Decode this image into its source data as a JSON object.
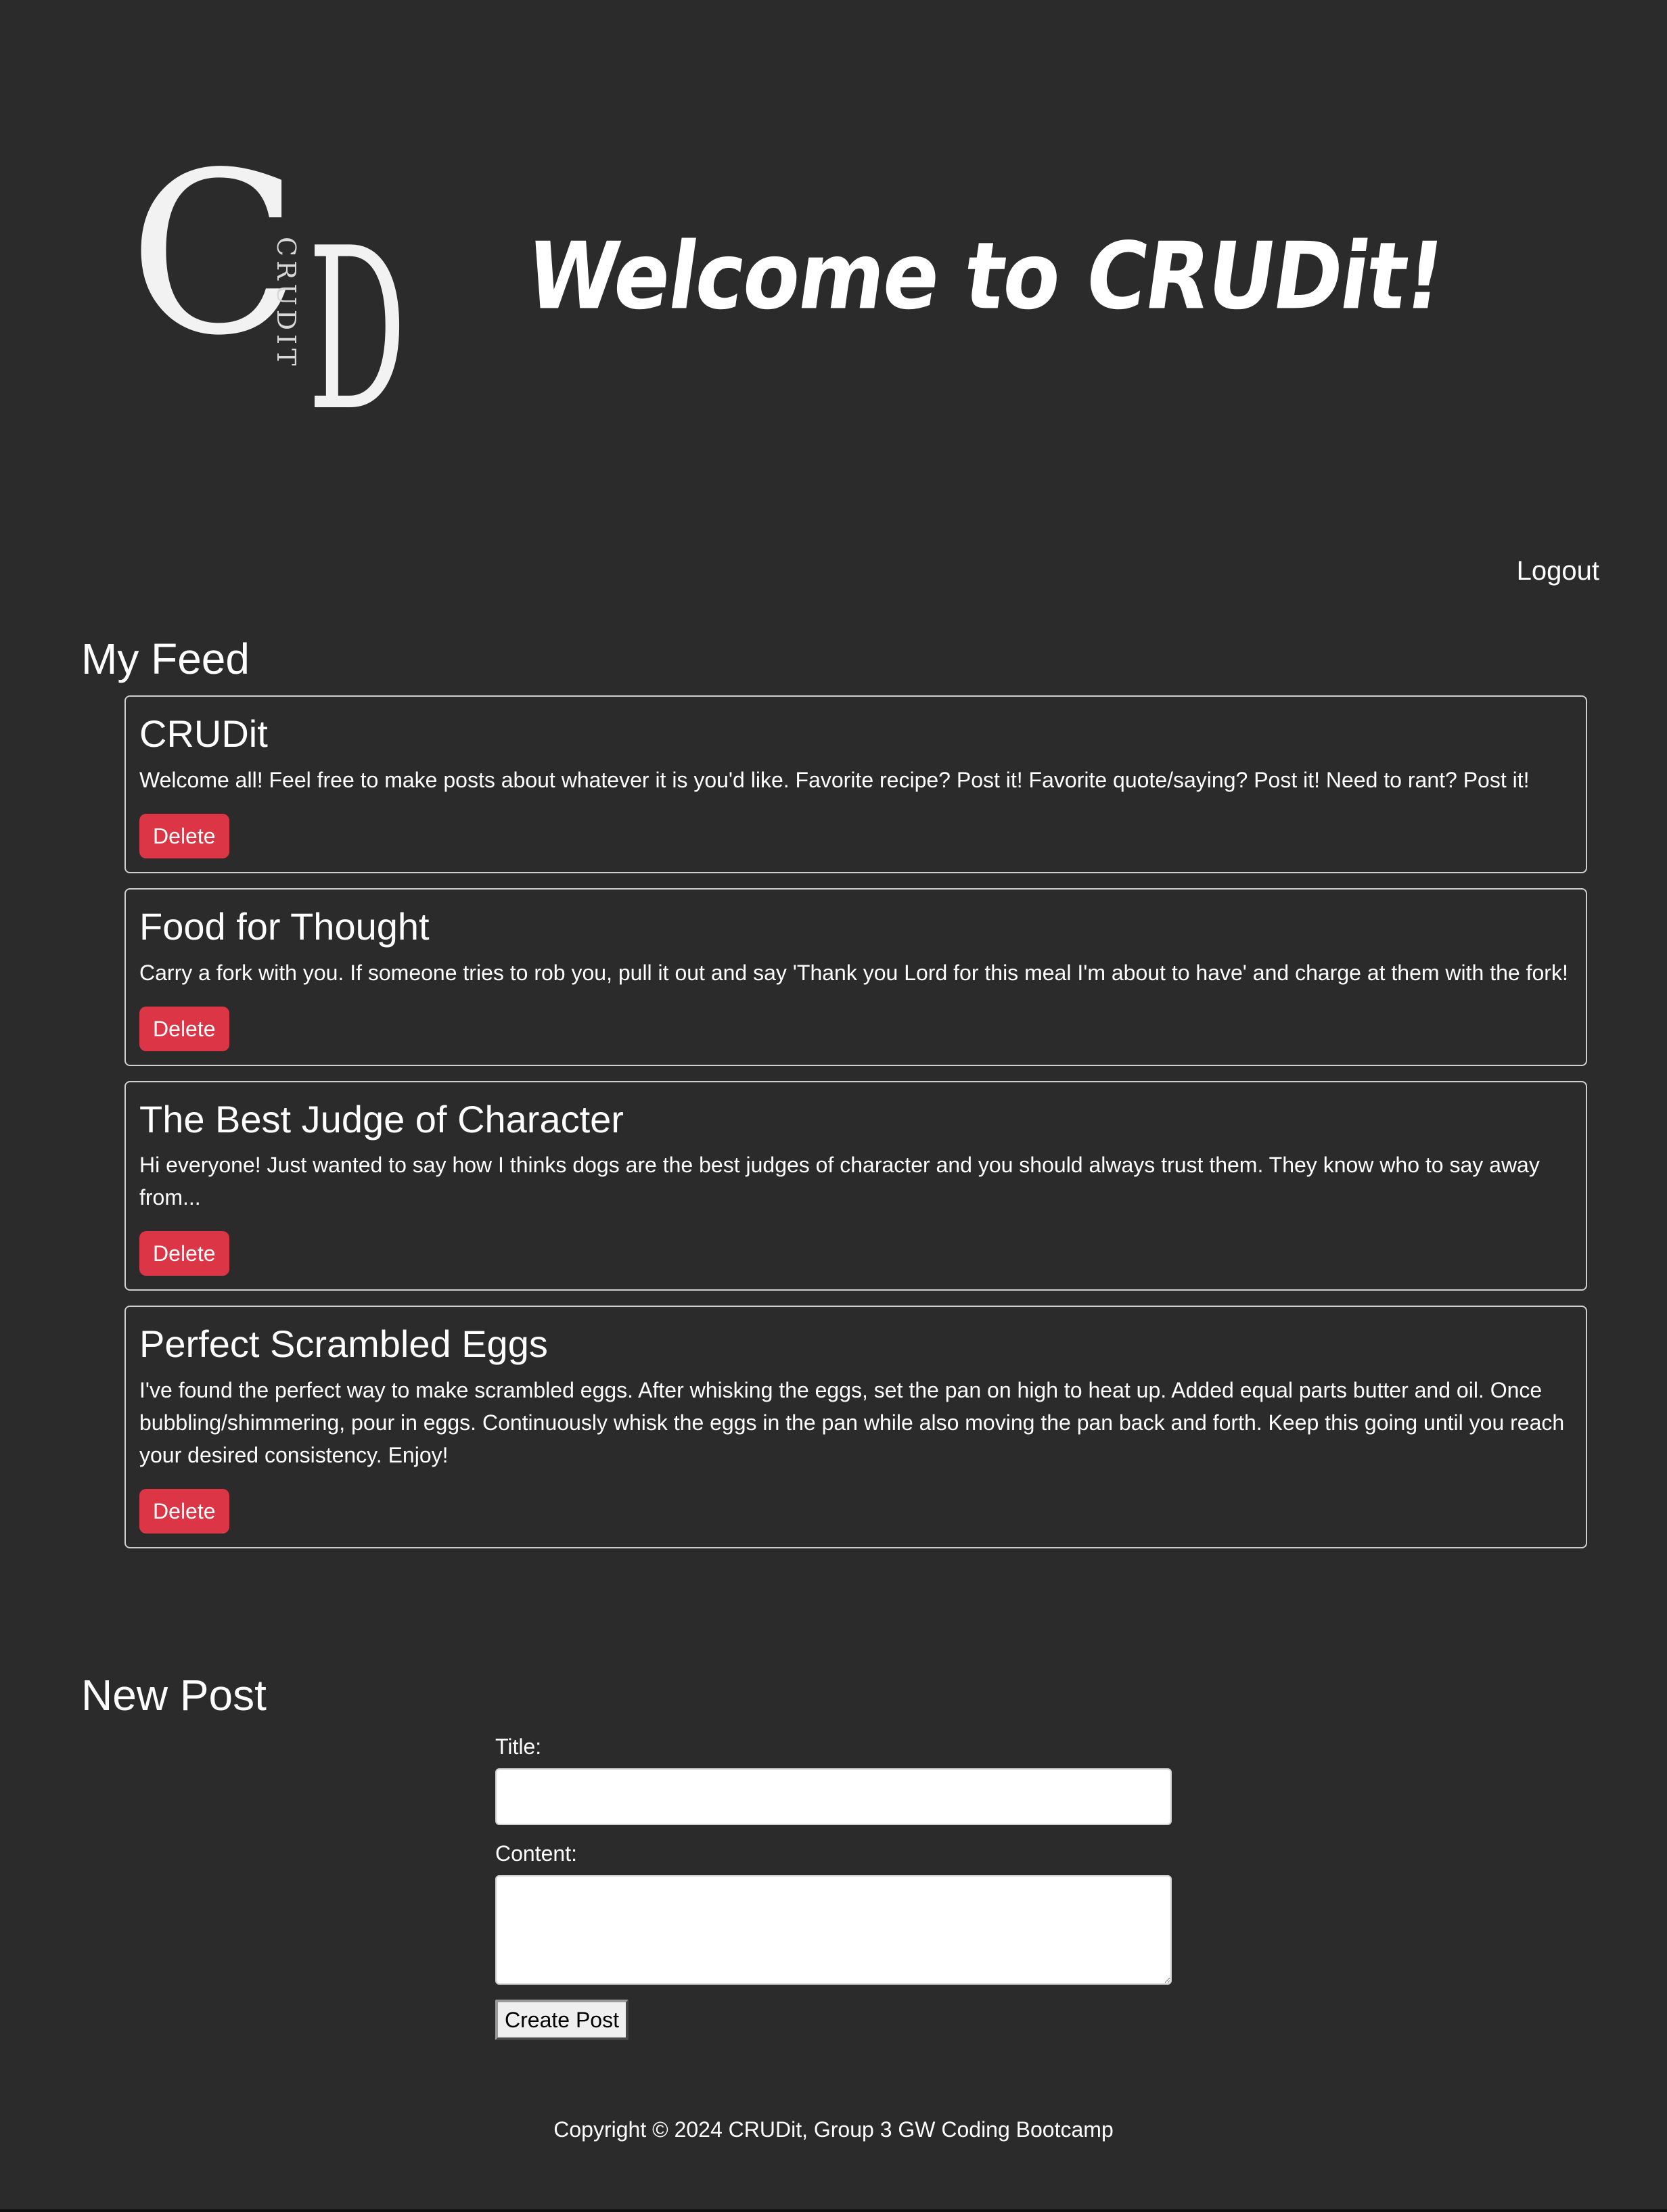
{
  "header": {
    "logo": {
      "letter_left": "C",
      "letter_right": "D",
      "vertical_text": "CRUDIT"
    },
    "title": "Welcome to CRUDit!",
    "logout_label": "Logout"
  },
  "feed": {
    "title": "My Feed",
    "posts": [
      {
        "title": "CRUDit",
        "content": "Welcome all! Feel free to make posts about whatever it is you'd like. Favorite recipe? Post it! Favorite quote/saying? Post it! Need to rant? Post it!",
        "delete_label": "Delete"
      },
      {
        "title": "Food for Thought",
        "content": "Carry a fork with you. If someone tries to rob you, pull it out and say 'Thank you Lord for this meal I'm about to have' and charge at them with the fork!",
        "delete_label": "Delete"
      },
      {
        "title": "The Best Judge of Character",
        "content": "Hi everyone! Just wanted to say how I thinks dogs are the best judges of character and you should always trust them. They know who to say away from...",
        "delete_label": "Delete"
      },
      {
        "title": "Perfect Scrambled Eggs",
        "content": "I've found the perfect way to make scrambled eggs. After whisking the eggs, set the pan on high to heat up. Added equal parts butter and oil. Once bubbling/shimmering, pour in eggs. Continuously whisk the eggs in the pan while also moving the pan back and forth. Keep this going until you reach your desired consistency. Enjoy!",
        "delete_label": "Delete"
      }
    ]
  },
  "new_post": {
    "title": "New Post",
    "title_label": "Title:",
    "title_value": "",
    "content_label": "Content:",
    "content_value": "",
    "submit_label": "Create Post"
  },
  "footer": {
    "copyright": "Copyright © 2024 CRUDit, Group 3 GW Coding Bootcamp"
  },
  "colors": {
    "background": "#2b2b2b",
    "text": "#ffffff",
    "delete_button": "#dc3545",
    "card_border": "#cfcfcf"
  }
}
